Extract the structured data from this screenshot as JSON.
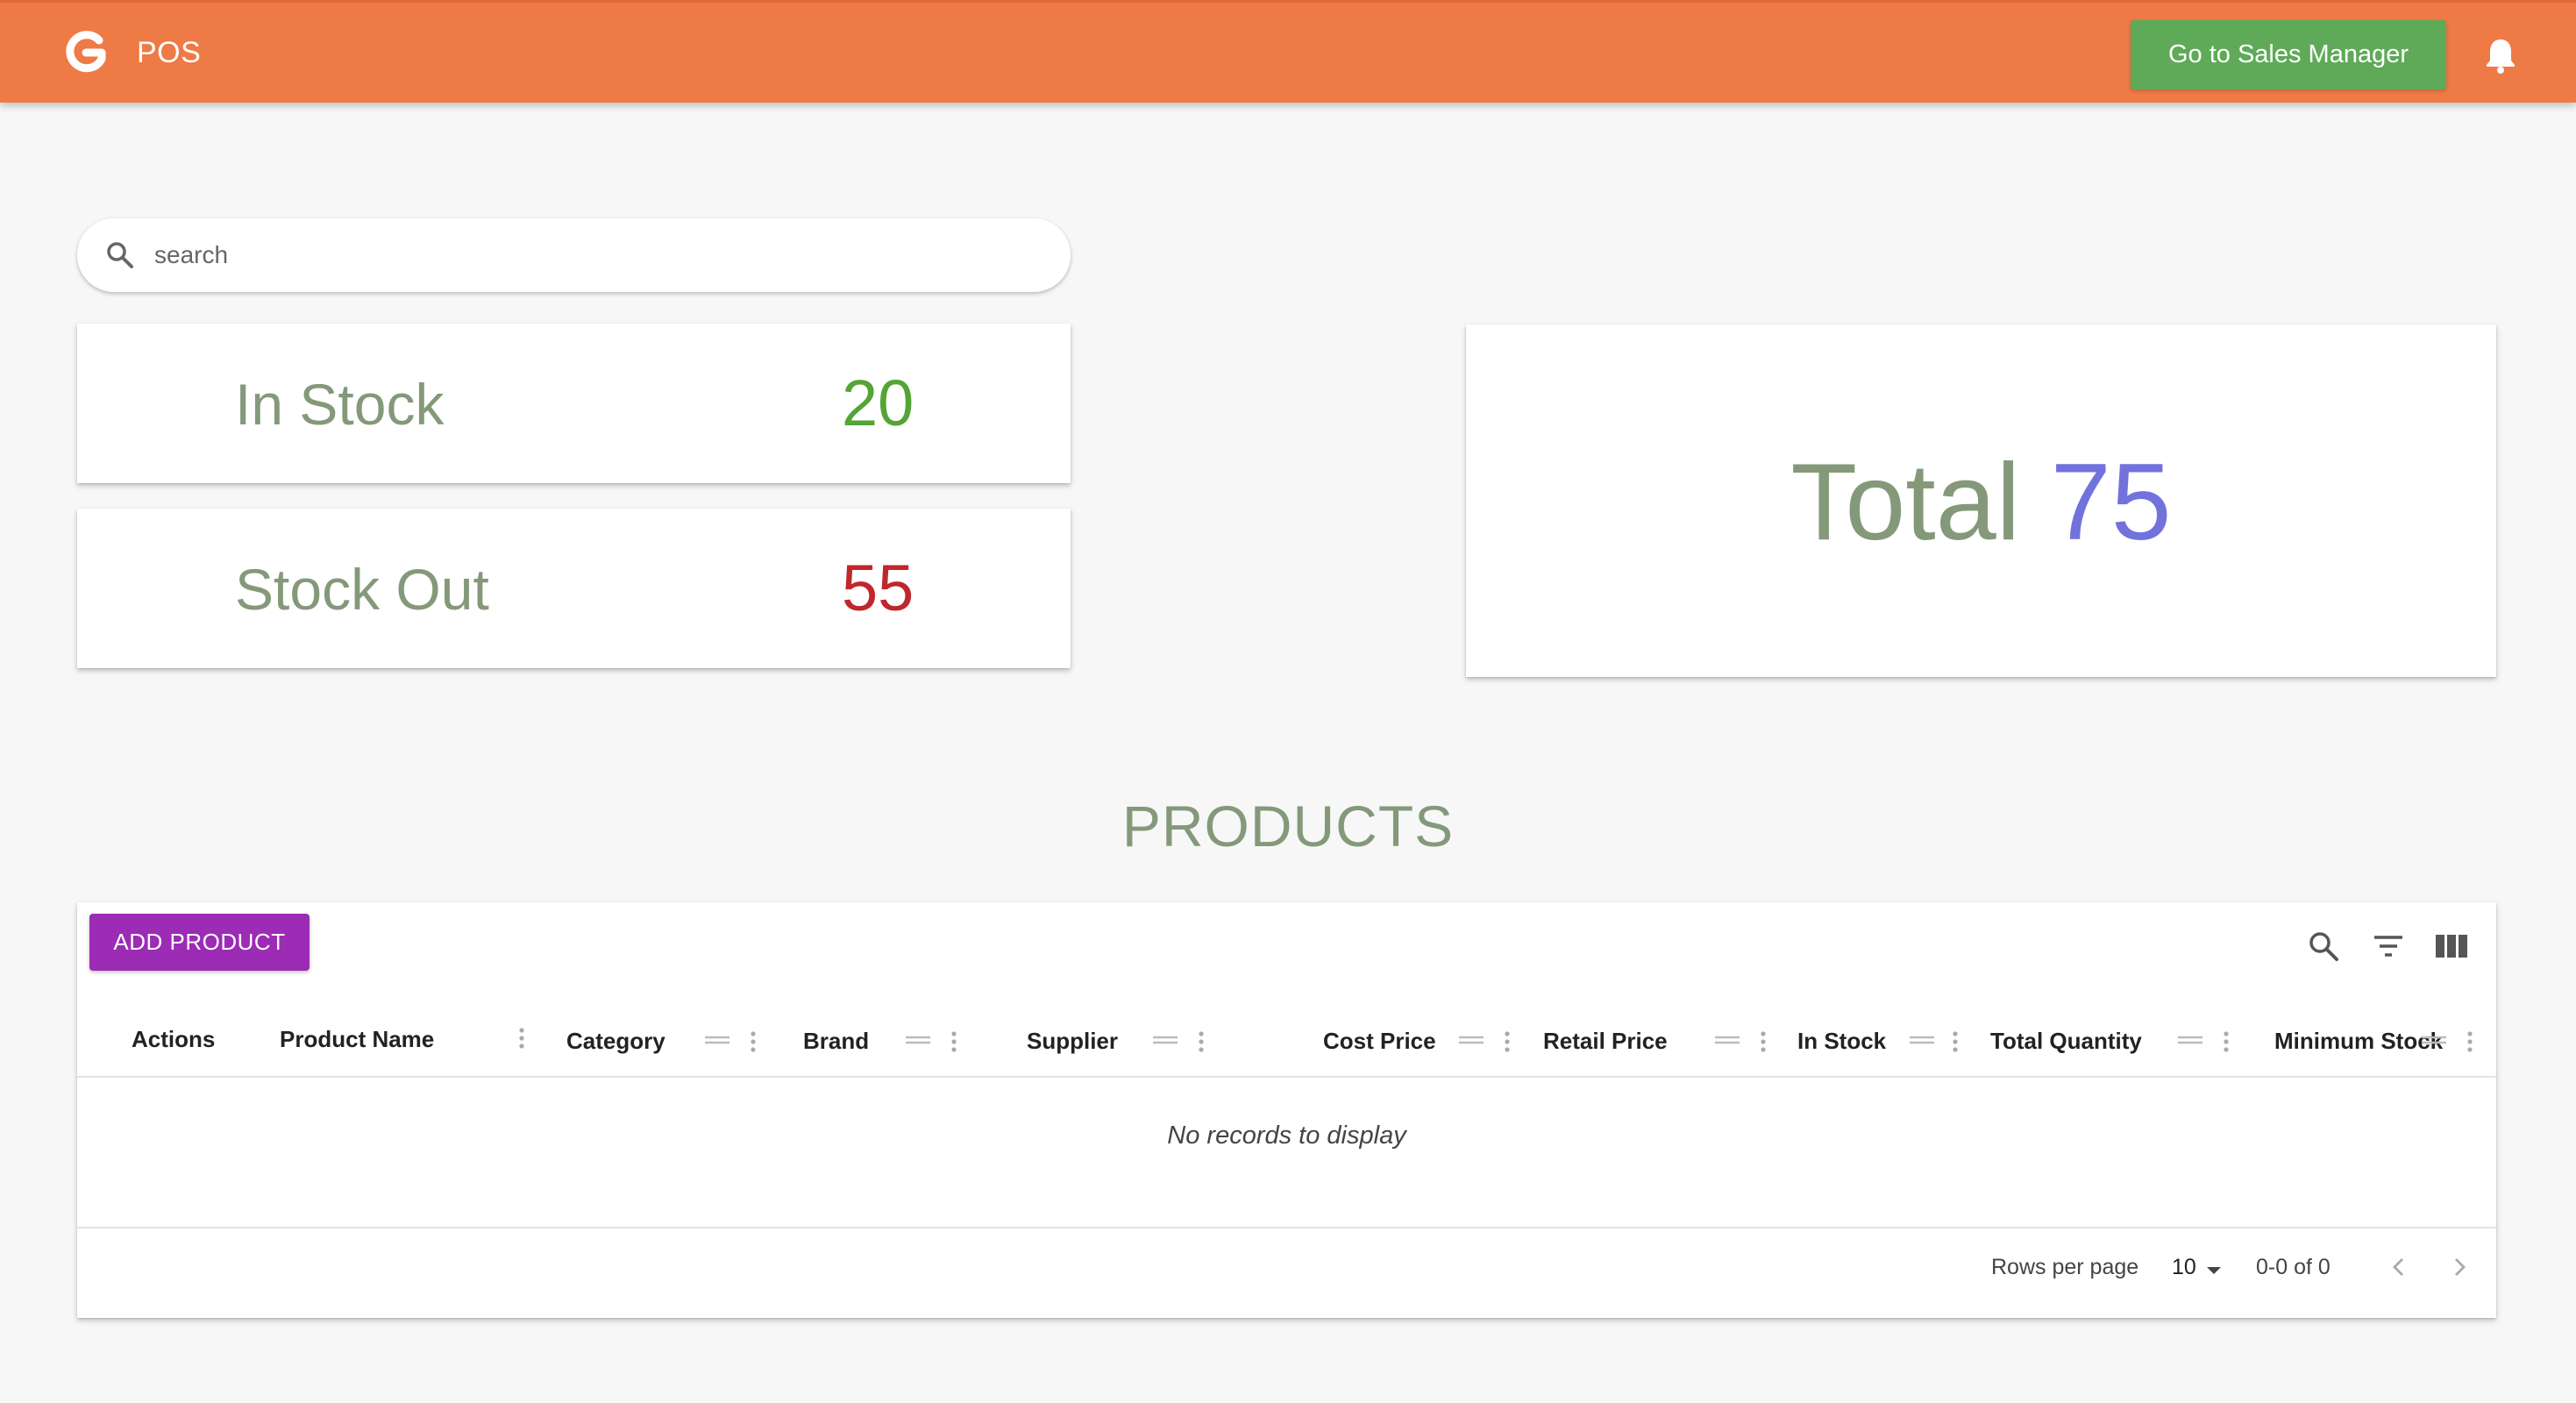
{
  "appbar": {
    "title": "POS",
    "sales_button": "Go to Sales Manager",
    "colors": {
      "appbar": "#ee7a46",
      "sales_button": "#5faa58"
    }
  },
  "search": {
    "placeholder": "search"
  },
  "stats": {
    "in_stock": {
      "label": "In Stock",
      "value": "20",
      "color": "#53a535"
    },
    "stock_out": {
      "label": "Stock Out",
      "value": "55",
      "color": "#c0272d"
    },
    "total": {
      "label": "Total",
      "value": "75",
      "color": "#7272dd"
    }
  },
  "products": {
    "title": "PRODUCTS",
    "add_button": "ADD PRODUCT",
    "add_button_color": "#9c2bb5",
    "columns": [
      "Actions",
      "Product Name",
      "Category",
      "Brand",
      "Supplier",
      "Cost Price",
      "Retail Price",
      "In Stock",
      "Total Quantity",
      "Minimum Stock"
    ],
    "empty_message": "No records to display",
    "footer": {
      "rows_per_page_label": "Rows per page",
      "rows_per_page_value": "10",
      "range": "0-0 of 0"
    }
  }
}
